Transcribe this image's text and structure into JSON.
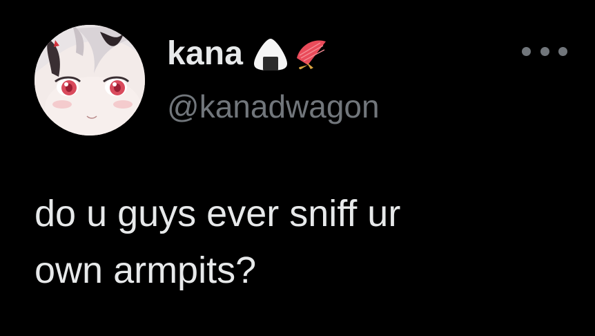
{
  "tweet": {
    "author": {
      "display_name": "kana",
      "handle": "@kanadwagon",
      "avatar_icon": "anime-girl-avatar-icon",
      "name_emojis": [
        "rice-ball-icon",
        "folding-fan-icon"
      ]
    },
    "more_icon": "more-options-icon",
    "text_line_1": "do u guys ever sniff ur",
    "text_line_2": "own armpits?"
  },
  "colors": {
    "background": "#000000",
    "primary_text": "#e7e9ea",
    "secondary_text": "#71767b",
    "fan_red": "#e94b5a",
    "fan_gold": "#d9a441"
  }
}
